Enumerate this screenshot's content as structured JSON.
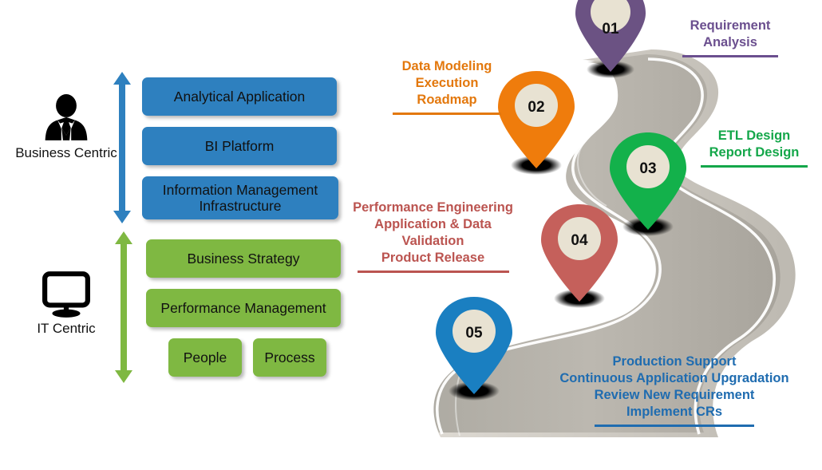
{
  "left_panel": {
    "personas": [
      {
        "id": "business-centric",
        "label": "Business Centric",
        "icon": "businessman-icon",
        "color": "#2e80bf"
      },
      {
        "id": "it-centric",
        "label": "IT Centric",
        "icon": "monitor-icon",
        "color": "#7fb842"
      }
    ],
    "business_stack": [
      {
        "label": "Analytical Application"
      },
      {
        "label": "BI Platform"
      },
      {
        "label": "Information Management Infrastructure"
      }
    ],
    "it_stack": [
      {
        "label": "Business Strategy"
      },
      {
        "label": "Performance Management"
      },
      {
        "label": "People"
      },
      {
        "label": "Process"
      }
    ]
  },
  "roadmap": {
    "title_hidden": "",
    "milestones": [
      {
        "number": "01",
        "pin_color": "#6b5283",
        "text_color": "#6b4f8f",
        "lines": [
          "Requirement",
          "Analysis"
        ]
      },
      {
        "number": "02",
        "pin_color": "#ef7c0c",
        "text_color": "#e3780d",
        "lines": [
          "Data Modeling",
          "Execution",
          "Roadmap"
        ]
      },
      {
        "number": "03",
        "pin_color": "#13b14b",
        "text_color": "#14a74a",
        "lines": [
          "ETL Design",
          "Report Design"
        ]
      },
      {
        "number": "04",
        "pin_color": "#c5605b",
        "text_color": "#bb5450",
        "lines": [
          "Performance Engineering",
          "Application & Data",
          "Validation",
          "Product Release"
        ]
      },
      {
        "number": "05",
        "pin_color": "#1a7fc1",
        "text_color": "#1f6cb0",
        "lines": [
          "Production Support",
          "Continuous Application Upgradation",
          "Review New Requirement",
          "Implement CRs"
        ]
      }
    ],
    "road_color": "#b5b2ab",
    "road_edge_color": "#d6d4cf",
    "pin_inner_color": "#e8e2d2"
  }
}
